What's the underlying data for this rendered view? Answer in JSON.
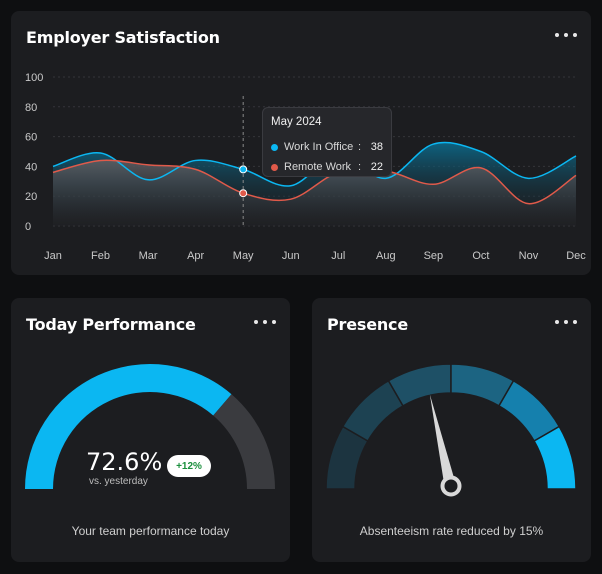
{
  "colors": {
    "background": "#0e0f11",
    "card": "#1c1d20",
    "accent_blue": "#0bb7f2",
    "accent_red": "#e05a4a",
    "gauge_gray": "#3a3b3f",
    "badge_green": "#1a8f3c"
  },
  "satisfaction": {
    "title": "Employer Satisfaction",
    "menu_icon": "more-horizontal-icon",
    "tooltip": {
      "month": "May 2024",
      "rows": [
        {
          "label": "Work In Office",
          "sep": ":",
          "value": "38"
        },
        {
          "label": "Remote Work",
          "sep": ":",
          "value": "22"
        }
      ]
    }
  },
  "chart_data": {
    "type": "area",
    "title": "Employer Satisfaction",
    "categories": [
      "Jan",
      "Feb",
      "Mar",
      "Apr",
      "May",
      "Jun",
      "Jul",
      "Aug",
      "Sep",
      "Oct",
      "Nov",
      "Dec"
    ],
    "y_ticks": [
      "100",
      "80",
      "60",
      "40",
      "20",
      "0"
    ],
    "ylim": [
      0,
      100
    ],
    "grid": true,
    "series": [
      {
        "name": "Work In Office",
        "color": "#0bb7f2",
        "values": [
          40,
          49,
          31,
          44,
          38,
          27,
          48,
          32,
          55,
          50,
          32,
          47
        ]
      },
      {
        "name": "Remote Work",
        "color": "#e05a4a",
        "values": [
          36,
          44,
          41,
          38,
          22,
          18,
          36,
          37,
          28,
          39,
          15,
          34
        ]
      }
    ],
    "highlight": "May"
  },
  "performance": {
    "title": "Today Performance",
    "menu_icon": "more-horizontal-icon",
    "value": "72.6%",
    "fraction": 0.726,
    "subtitle": "vs. yesterday",
    "badge": "+12%",
    "caption": "Your team performance today"
  },
  "presence": {
    "title": "Presence",
    "menu_icon": "more-horizontal-icon",
    "caption": "Absenteeism rate reduced by 15%",
    "segments": 6,
    "active_segment": 6,
    "needle_level": 0.43
  }
}
